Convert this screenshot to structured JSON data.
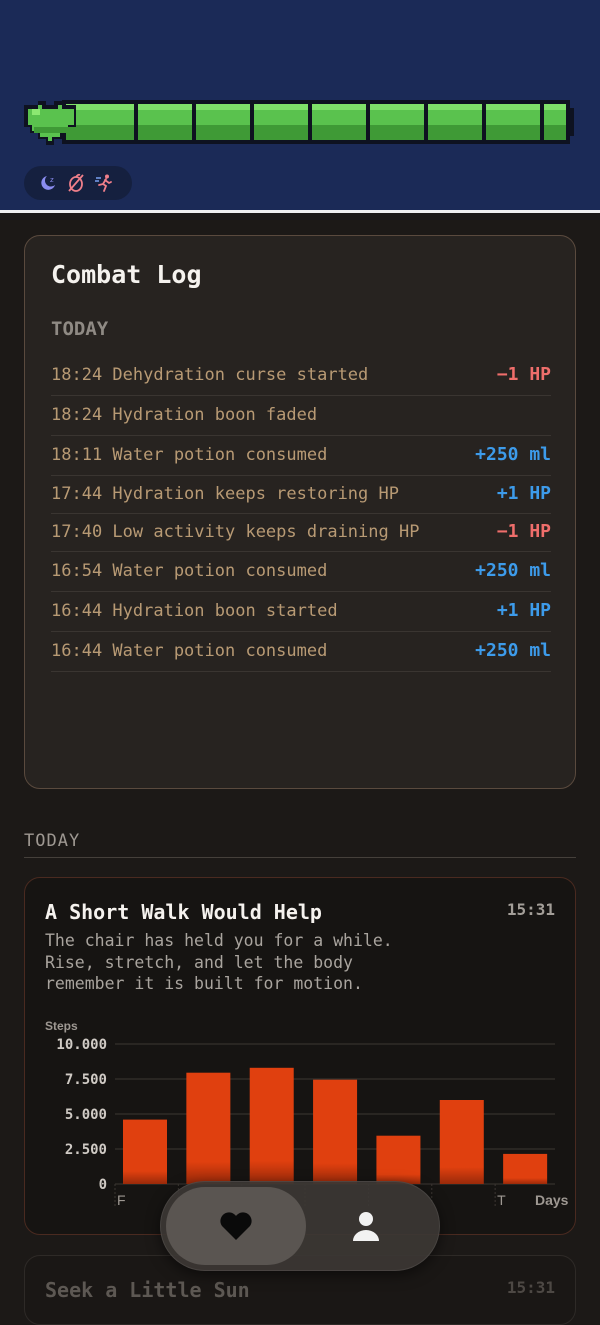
{
  "header": {
    "status_icons": [
      "moon-sleep-icon",
      "no-food-icon",
      "running-icon"
    ],
    "hp_segments": 9
  },
  "combat_log": {
    "title": "Combat Log",
    "section": "TODAY",
    "rows": [
      {
        "text": "18:24 Dehydration curse started",
        "delta": "−1 HP",
        "kind": "neg"
      },
      {
        "text": "18:24 Hydration boon faded",
        "delta": "",
        "kind": "none"
      },
      {
        "text": "18:11 Water potion consumed",
        "delta": "+250 ml",
        "kind": "pos"
      },
      {
        "text": "17:44 Hydration keeps restoring HP",
        "delta": "+1 HP",
        "kind": "pos"
      },
      {
        "text": "17:40 Low activity keeps draining HP",
        "delta": "−1 HP",
        "kind": "neg"
      },
      {
        "text": "16:54 Water potion consumed",
        "delta": "+250 ml",
        "kind": "pos"
      },
      {
        "text": "16:44 Hydration boon started",
        "delta": "+1 HP",
        "kind": "pos"
      },
      {
        "text": "16:44 Water potion consumed",
        "delta": "+250 ml",
        "kind": "pos"
      }
    ]
  },
  "feed": {
    "section_label": "TODAY",
    "notification": {
      "title": "A Short Walk Would Help",
      "time": "15:31",
      "body": "The chair has held you for a while. Rise, stretch, and let the body remember it is built for motion."
    },
    "next_notification": {
      "title": "Seek a Little Sun",
      "time": "15:31"
    }
  },
  "chart_data": {
    "type": "bar",
    "ylabel": "Steps",
    "xlabel": "Days",
    "yticks": [
      "10.000",
      "7.500",
      "5.000",
      "2.500",
      "0"
    ],
    "ylim": [
      0,
      10000
    ],
    "categories": [
      "F",
      "",
      "",
      "",
      "",
      "",
      "T"
    ],
    "values": [
      4600,
      7950,
      8300,
      7450,
      3450,
      6000,
      2150
    ],
    "color": "#e0400f",
    "grid": true
  },
  "tabbar": {
    "tabs": [
      "heart-icon",
      "profile-icon"
    ],
    "selected": 0
  }
}
